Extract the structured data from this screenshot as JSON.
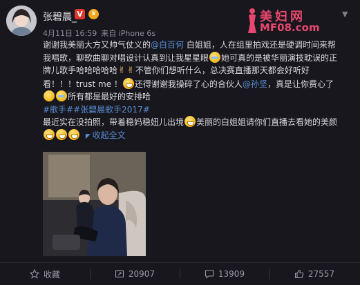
{
  "post": {
    "author": "张碧晨_",
    "date": "4月11日 16:59",
    "source": "来自 iPhone 6s",
    "line1a": "谢谢我美丽大方又帅气仗义的",
    "mention1": "@白百何",
    "line1b": " 白姐姐，人在组里拍戏还是硬调时间来帮",
    "line2": "我唱歌，聊歌曲聊对唱设计认真到让我星星眼",
    "line2b": "她可真的是被华丽演技耽误的正",
    "line3": "牌儿歌手哈哈哈哈哈",
    "line3b": "不管你们想听什么，总决赛直播那天都会好听好",
    "line4": "看！！！trust me ！",
    "line4b": "还得谢谢我操碎了心的合伙人",
    "mention2": "@孙坚",
    "line4c": "，真是让你费心了",
    "line5": "所有都是最好的安排哈",
    "topics": "#歌手##张碧晨歌手2017#",
    "line6": "最近实在没拍照，带着稳妈稳妞儿出境",
    "line6b": "美丽的白姐姐请你们直播去看她的美颜",
    "collapse_label": "收起全文"
  },
  "watermark": {
    "cn": "美妇网",
    "en": "MF08.com"
  },
  "actions": {
    "favorite": "收藏",
    "repost": "20907",
    "comment": "13909",
    "like": "27557"
  },
  "icons": {
    "favorite": "star-icon",
    "repost": "repost-icon",
    "comment": "comment-icon",
    "like": "thumbs-up-icon"
  },
  "colors": {
    "link": "#5b8fd6",
    "watermark": "#e8476f",
    "verified": "#e0352b"
  }
}
